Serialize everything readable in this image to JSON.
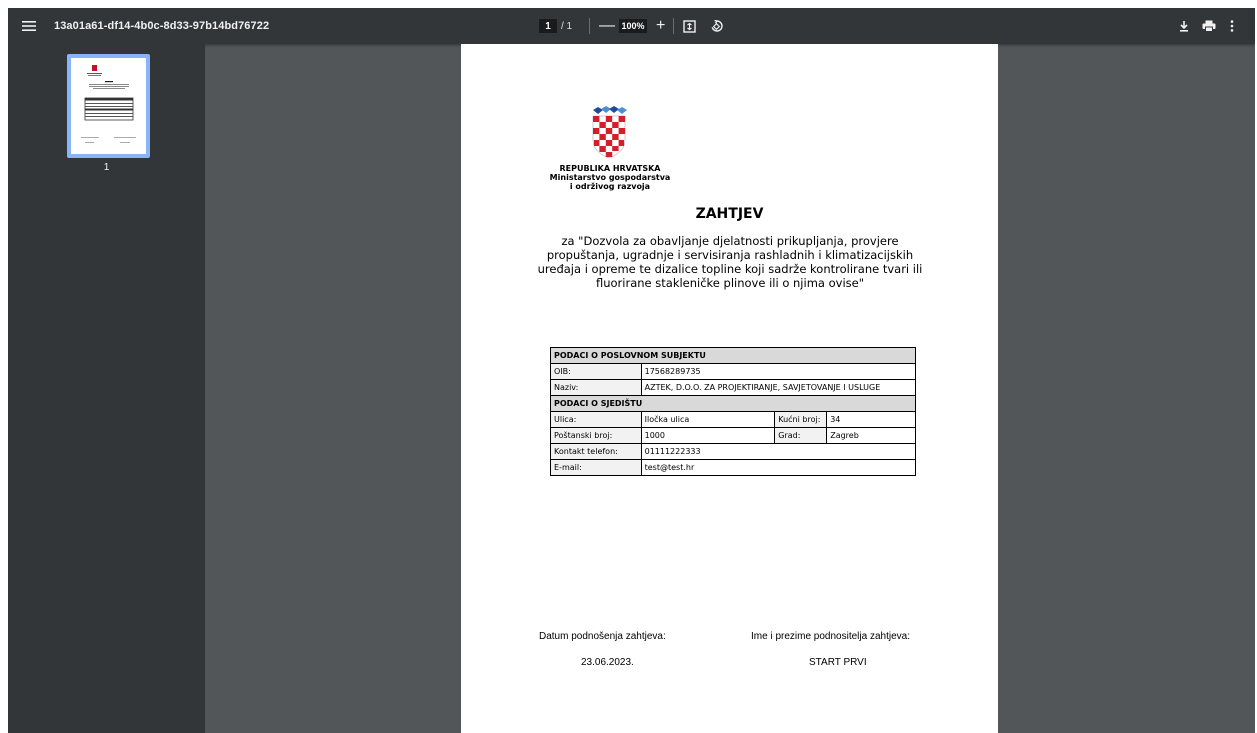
{
  "toolbar": {
    "file_name": "13a01a61-df14-4b0c-8d33-97b14bd76722",
    "current_page": "1",
    "page_total": "/ 1",
    "zoom_out": "—",
    "zoom_level": "100%",
    "zoom_in": "+",
    "icons": [
      "menu-icon",
      "fit-page-icon",
      "rotate-icon",
      "download-icon",
      "print-icon",
      "more-icon"
    ]
  },
  "sidebar": {
    "thumbnails": [
      {
        "page_number": "1"
      }
    ]
  },
  "document": {
    "institution": [
      "REPUBLIKA HRVATSKA",
      "Ministarstvo gospodarstva",
      "i održivog razvoja"
    ],
    "heading": "ZAHTJEV",
    "subtitle": "za \"Dozvola za obavljanje djelatnosti prikupljanja, provjere propuštanja, ugradnje i servisiranja rashladnih i klimatizacijskih uređaja i opreme te dizalice topline koji sadrže kontrolirane tvari ili fluorirane stakleničke plinove ili o njima ovise\"",
    "table": {
      "section_business": "PODACI O POSLOVNOM SUBJEKTU",
      "oib_label": "OIB:",
      "oib_value": "17568289735",
      "name_label": "Naziv:",
      "name_value": "AZTEK, D.O.O. ZA PROJEKTIRANJE, SAVJETOVANJE I USLUGE",
      "section_seat": "PODACI O SJEDIŠTU",
      "street_label": "Ulica:",
      "street_value": "Iločka ulica",
      "house_label": "Kućni broj:",
      "house_value": "34",
      "postal_label": "Poštanski broj:",
      "postal_value": "1000",
      "city_label": "Grad:",
      "city_value": "Zagreb",
      "phone_label": "Kontakt telefon:",
      "phone_value": "01111222333",
      "email_label": "E-mail:",
      "email_value": "test@test.hr"
    },
    "date_label": "Datum podnošenja zahtjeva:",
    "date_value": "23.06.2023.",
    "applicant_label": "Ime i prezime podnositelja zahtjeva:",
    "applicant_value": "START PRVI"
  },
  "colors": {
    "toolbar_bg": "#323639",
    "viewer_bg": "#525659",
    "thumbnail_border": "#8ab4f8",
    "table_header_bg": "#d9d9d9"
  }
}
